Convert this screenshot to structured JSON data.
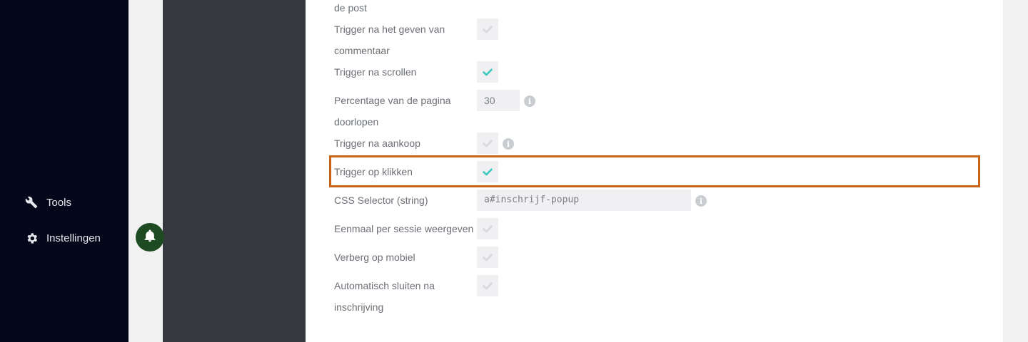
{
  "sidebar": {
    "items": [
      {
        "label": "Tools",
        "icon": "wrench-icon"
      },
      {
        "label": "Instellingen",
        "icon": "gear-icon"
      }
    ]
  },
  "settings": {
    "rows": [
      {
        "label": "de post"
      },
      {
        "label": "Trigger na het geven van commentaar",
        "checked": false
      },
      {
        "label": "Trigger na scrollen",
        "checked": true
      },
      {
        "label": "Percentage van de pagina doorlopen",
        "value": "30"
      },
      {
        "label": "Trigger na aankoop",
        "checked": false
      },
      {
        "label": "Trigger op klikken",
        "checked": true,
        "highlighted": true
      },
      {
        "label": "CSS Selector (string)",
        "value": "a#inschrijf-popup"
      },
      {
        "label": "Eenmaal per sessie weergeven",
        "checked": false
      },
      {
        "label": "Verberg op mobiel",
        "checked": false
      },
      {
        "label": "Automatisch sluiten na inschrijving",
        "checked": false
      }
    ]
  },
  "colors": {
    "sidebar_bg": "#04061a",
    "check_active": "#3ec9c0",
    "check_inactive": "#d6d8dc",
    "highlight_border": "#c8651b",
    "bell_bg": "#1e4a22"
  }
}
